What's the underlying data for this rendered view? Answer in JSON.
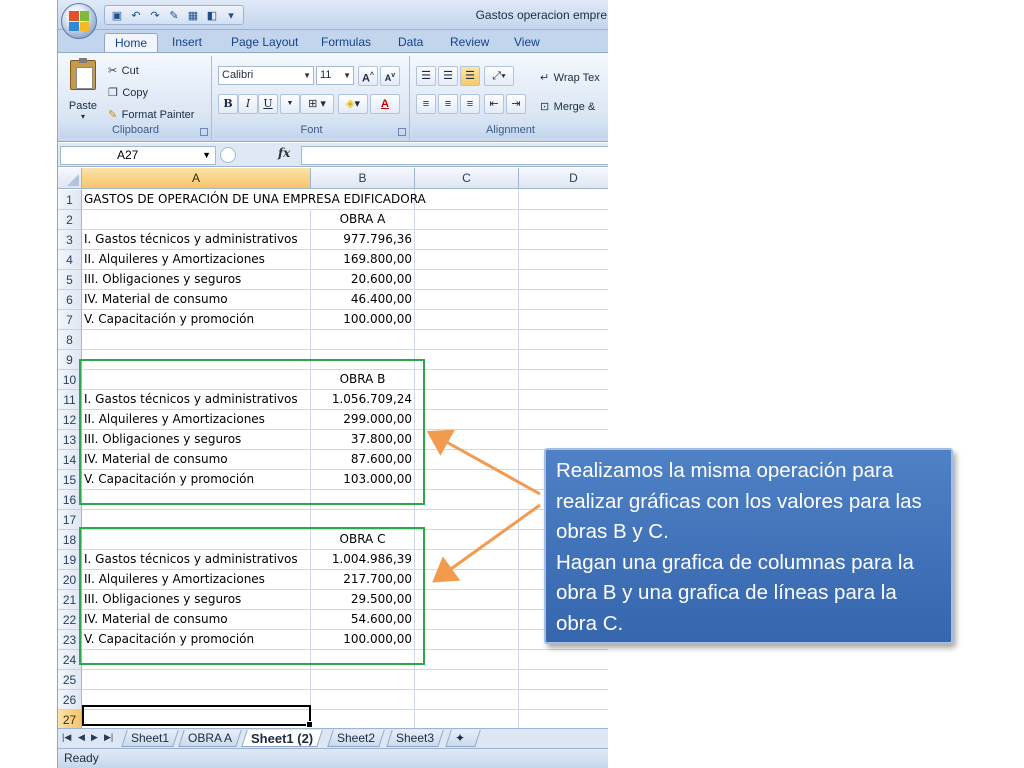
{
  "window": {
    "title": "Gastos operacion empre"
  },
  "tabs": [
    "Home",
    "Insert",
    "Page Layout",
    "Formulas",
    "Data",
    "Review",
    "View"
  ],
  "ribbon": {
    "clipboard": {
      "label": "Clipboard",
      "paste": "Paste",
      "cut": "Cut",
      "copy": "Copy",
      "format_painter": "Format Painter"
    },
    "font": {
      "label": "Font",
      "font_name": "Calibri",
      "font_size": "11",
      "bold": "B",
      "italic": "I",
      "underline": "U",
      "font_color_glyph": "A"
    },
    "alignment": {
      "label": "Alignment",
      "wrap_text": "Wrap Tex",
      "merge": "Merge &"
    }
  },
  "formula_bar": {
    "name_box": "A27",
    "fx": "fx",
    "formula": ""
  },
  "columns": [
    "A",
    "B",
    "C",
    "D"
  ],
  "rows": [
    {
      "n": "1",
      "a": "GASTOS DE OPERACIÓN DE UNA EMPRESA EDIFICADORA",
      "b": ""
    },
    {
      "n": "2",
      "a": "",
      "b": "OBRA A"
    },
    {
      "n": "3",
      "a": "I. Gastos técnicos y administrativos",
      "b": "977.796,36"
    },
    {
      "n": "4",
      "a": "II. Alquileres y Amortizaciones",
      "b": "169.800,00"
    },
    {
      "n": "5",
      "a": "III. Obligaciones y seguros",
      "b": "20.600,00"
    },
    {
      "n": "6",
      "a": "IV. Material de consumo",
      "b": "46.400,00"
    },
    {
      "n": "7",
      "a": "V. Capacitación y promoción",
      "b": "100.000,00"
    },
    {
      "n": "8",
      "a": "",
      "b": ""
    },
    {
      "n": "9",
      "a": "",
      "b": ""
    },
    {
      "n": "10",
      "a": "",
      "b": "OBRA B"
    },
    {
      "n": "11",
      "a": "I. Gastos técnicos y administrativos",
      "b": "1.056.709,24"
    },
    {
      "n": "12",
      "a": "II. Alquileres y Amortizaciones",
      "b": "299.000,00"
    },
    {
      "n": "13",
      "a": "III. Obligaciones y seguros",
      "b": "37.800,00"
    },
    {
      "n": "14",
      "a": "IV. Material de consumo",
      "b": "87.600,00"
    },
    {
      "n": "15",
      "a": "V. Capacitación y promoción",
      "b": "103.000,00"
    },
    {
      "n": "16",
      "a": "",
      "b": ""
    },
    {
      "n": "17",
      "a": "",
      "b": ""
    },
    {
      "n": "18",
      "a": "",
      "b": "OBRA C"
    },
    {
      "n": "19",
      "a": "I. Gastos técnicos y administrativos",
      "b": "1.004.986,39"
    },
    {
      "n": "20",
      "a": "II. Alquileres y Amortizaciones",
      "b": "217.700,00"
    },
    {
      "n": "21",
      "a": "III. Obligaciones y seguros",
      "b": "29.500,00"
    },
    {
      "n": "22",
      "a": "IV. Material de consumo",
      "b": "54.600,00"
    },
    {
      "n": "23",
      "a": "V. Capacitación y promoción",
      "b": "100.000,00"
    },
    {
      "n": "24",
      "a": "",
      "b": ""
    },
    {
      "n": "25",
      "a": "",
      "b": ""
    },
    {
      "n": "26",
      "a": "",
      "b": ""
    },
    {
      "n": "27",
      "a": "",
      "b": ""
    }
  ],
  "sheet_tabs": [
    "Sheet1",
    "OBRA A",
    "Sheet1 (2)",
    "Sheet2",
    "Sheet3"
  ],
  "active_sheet": "Sheet1 (2)",
  "status": "Ready",
  "callout": {
    "text": "Realizamos la misma operación para realizar gráficas  con los valores para las obras B y C.\nHagan  una grafica de columnas para la obra B y una grafica de líneas para la  obra C."
  },
  "colors": {
    "highlight_box": "#2aa84a",
    "arrow": "#f29a4d",
    "callout_fill": "#4577bd"
  }
}
